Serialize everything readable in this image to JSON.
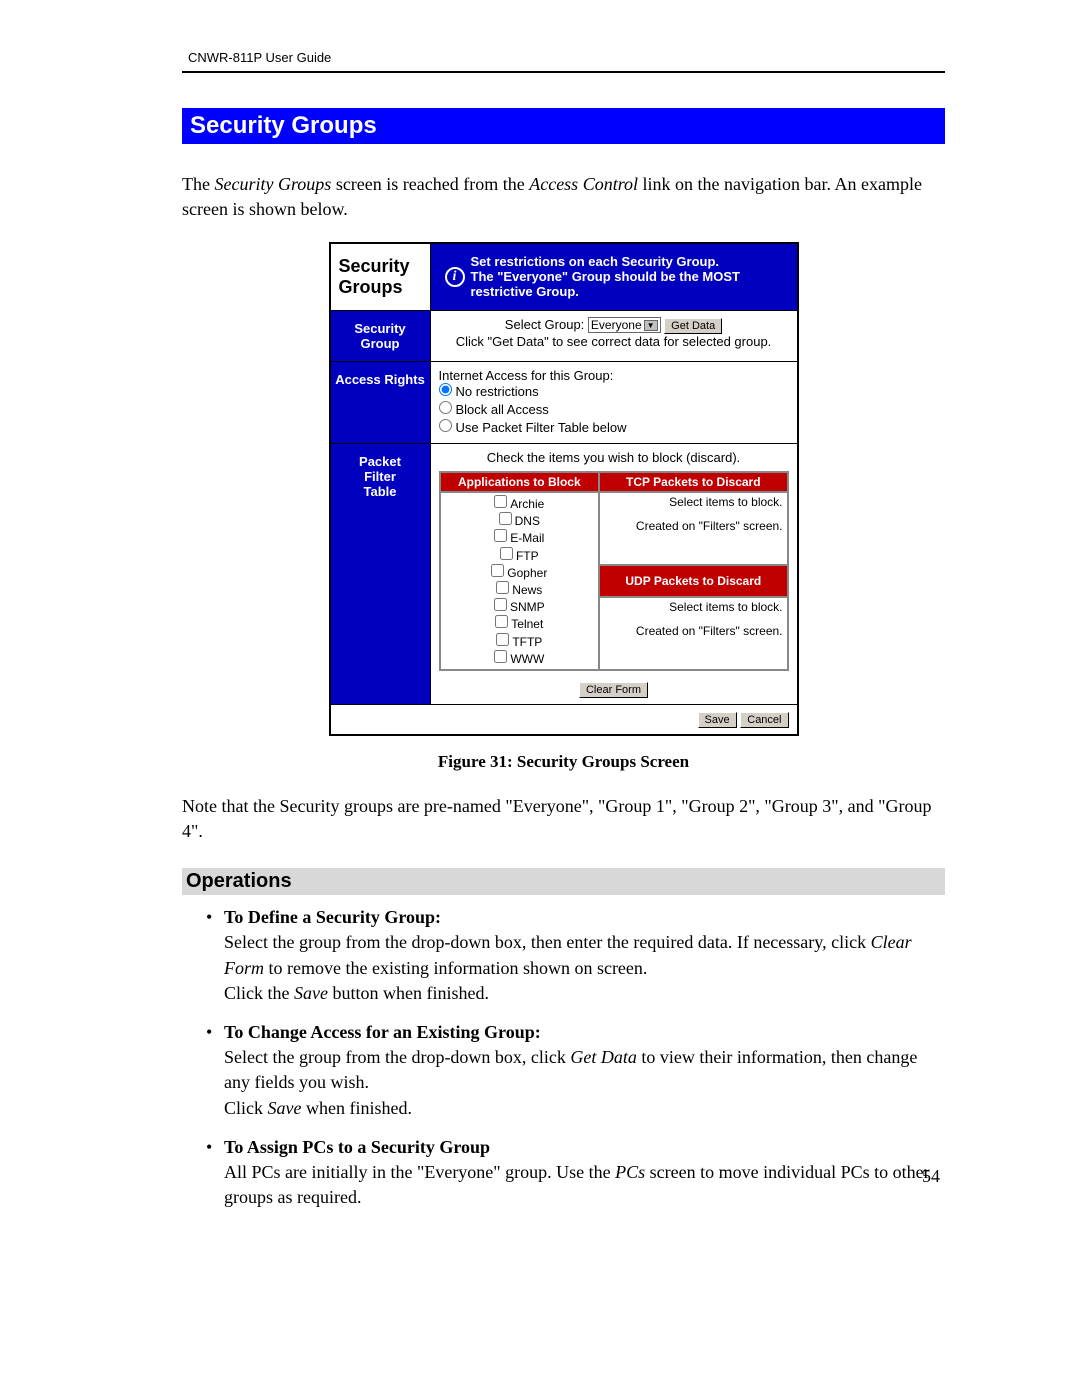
{
  "header": {
    "guide": "CNWR-811P User Guide"
  },
  "title": "Security Groups",
  "intro": {
    "pre": "The ",
    "em1": "Security Groups",
    "mid": " screen is reached from the ",
    "em2": "Access Control",
    "post": " link on the navigation bar. An example screen is shown below."
  },
  "screenshot": {
    "panel_title_l1": "Security",
    "panel_title_l2": "Groups",
    "info_l1": "Set restrictions on each Security Group.",
    "info_l2": "The \"Everyone\" Group should be the MOST",
    "info_l3": "restrictive Group.",
    "row_sec_label": "Security Group",
    "select_label": "Select Group:",
    "select_value": "Everyone",
    "get_data_btn": "Get Data",
    "select_hint": "Click \"Get Data\" to see correct data for selected group.",
    "row_access_label": "Access Rights",
    "access_heading": "Internet Access for this Group:",
    "access_opt1": "No restrictions",
    "access_opt2": "Block all Access",
    "access_opt3": "Use Packet Filter Table below",
    "row_packet_l1": "Packet",
    "row_packet_l2": "Filter",
    "row_packet_l3": "Table",
    "packet_hint": "Check the items you wish to block (discard).",
    "apps_header": "Applications to Block",
    "tcp_header": "TCP Packets to Discard",
    "udp_header": "UDP Packets to Discard",
    "apps": [
      "Archie",
      "DNS",
      "E-Mail",
      "FTP",
      "Gopher",
      "News",
      "SNMP",
      "Telnet",
      "TFTP",
      "WWW"
    ],
    "select_items_msg": "Select items to block.",
    "created_msg": "Created on \"Filters\" screen.",
    "clear_btn": "Clear Form",
    "save_btn": "Save",
    "cancel_btn": "Cancel"
  },
  "figure_caption": "Figure 31: Security Groups Screen",
  "note": "Note that the Security groups are pre-named \"Everyone\", \"Group 1\", \"Group 2\", \"Group 3\", and \"Group 4\".",
  "operations_heading": "Operations",
  "ops": [
    {
      "title": "To Define a Security Group:",
      "l1a": "Select the group from the drop-down box, then enter the required data. If necessary, click ",
      "l1em": "Clear Form",
      "l1b": " to remove the existing information shown on screen.",
      "l2a": "Click the ",
      "l2em": "Save",
      "l2b": " button when finished."
    },
    {
      "title": "To Change Access for an Existing Group:",
      "l1a": "Select the group from the drop-down box, click ",
      "l1em": "Get Data",
      "l1b": " to view their information, then change any fields you wish.",
      "l2a": "Click ",
      "l2em": "Save",
      "l2b": " when finished."
    },
    {
      "title": "To Assign PCs to a Security Group",
      "l1a": "All PCs are initially in the \"Everyone\" group. Use the ",
      "l1em": "PCs",
      "l1b": " screen to move individual PCs to other groups as required.",
      "l2a": "",
      "l2em": "",
      "l2b": ""
    }
  ],
  "page_number": "54"
}
